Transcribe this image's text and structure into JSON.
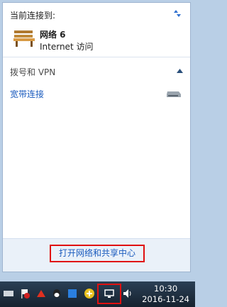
{
  "flyout": {
    "connected_title": "当前连接到:",
    "network": {
      "name": "网络  6",
      "access": "Internet 访问"
    },
    "dialup_section": {
      "title": "拨号和 VPN",
      "items": [
        {
          "label": "宽带连接"
        }
      ]
    },
    "footer": {
      "open_center_label": "打开网络和共享中心"
    }
  },
  "taskbar": {
    "clock": {
      "time": "10:30",
      "date": "2016-11-24"
    },
    "icons": [
      "keyboard-icon",
      "flag-icon",
      "red-tray-icon",
      "qq-icon",
      "blue-app-icon",
      "green-plus-icon",
      "network-icon",
      "volume-icon"
    ]
  },
  "colors": {
    "link": "#1a5bbe",
    "highlight": "#e01010",
    "taskbar": "#1e2f40"
  }
}
